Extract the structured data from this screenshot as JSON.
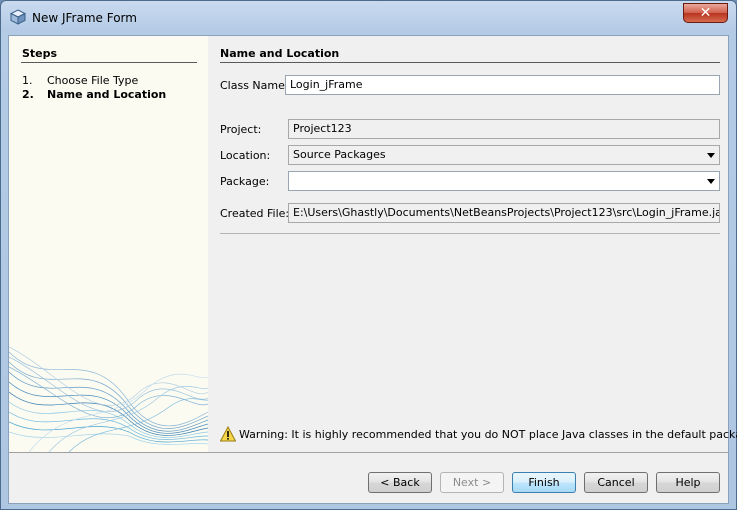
{
  "window": {
    "title": "New JFrame Form"
  },
  "steps": {
    "heading": "Steps",
    "items": [
      {
        "num": "1.",
        "label": "Choose File Type"
      },
      {
        "num": "2.",
        "label": "Name and Location"
      }
    ]
  },
  "form": {
    "section_title": "Name and Location",
    "class_name_label": "Class Name:",
    "class_name_value": "Login_jFrame",
    "project_label": "Project:",
    "project_value": "Project123",
    "location_label": "Location:",
    "location_value": "Source Packages",
    "package_label": "Package:",
    "package_value": "",
    "created_file_label": "Created File:",
    "created_file_value": "E:\\Users\\Ghastly\\Documents\\NetBeansProjects\\Project123\\src\\Login_jFrame.java"
  },
  "warning": {
    "text": "Warning: It is highly recommended that you do NOT place Java classes in the default package."
  },
  "buttons": {
    "back": "< Back",
    "next": "Next >",
    "finish": "Finish",
    "cancel": "Cancel",
    "help": "Help"
  },
  "colors": {
    "title_bar": "#b4cbe6",
    "steps_panel": "#fbfbf1",
    "close_button": "#c94a36"
  }
}
